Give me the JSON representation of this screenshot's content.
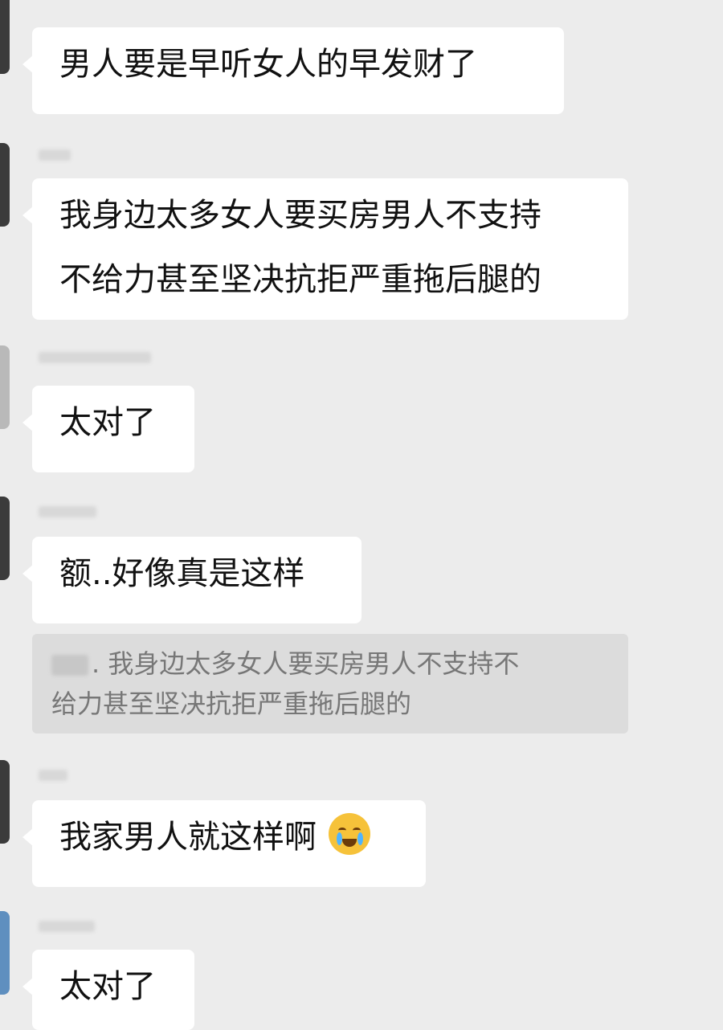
{
  "messages": [
    {
      "text": "男人要是早听女人的早发财了"
    },
    {
      "line1": "我身边太多女人要买房男人不支持",
      "line2": "不给力甚至坚决抗拒严重拖后腿的"
    },
    {
      "text": "太对了"
    },
    {
      "text": "额..好像真是这样"
    },
    {
      "text": "我家男人就这样啊",
      "emoji": "crying-laughing-emoji"
    },
    {
      "text": "太对了"
    }
  ],
  "quote": {
    "line1": ". 我身边太多女人要买房男人不支持不",
    "line2": "给力甚至坚决抗拒严重拖后腿的"
  }
}
